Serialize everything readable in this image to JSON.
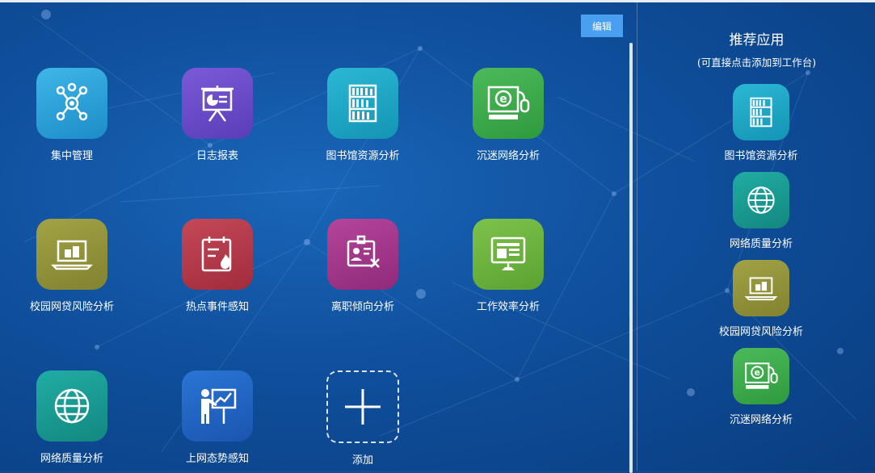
{
  "workspace": {
    "edit_label": "编辑",
    "apps": [
      {
        "label": "集中管理",
        "icon": "network-hub-icon",
        "color": "#2f9ed6"
      },
      {
        "label": "日志报表",
        "icon": "presentation-report-icon",
        "color": "#6a4fc8"
      },
      {
        "label": "图书馆资源分析",
        "icon": "bookshelf-icon",
        "color": "#1ba3c4"
      },
      {
        "label": "沉迷网络分析",
        "icon": "computer-e-mouse-icon",
        "color": "#3aa84a"
      },
      {
        "label": "校园网贷风险分析",
        "icon": "laptop-money-icon",
        "color": "#8f8f3a"
      },
      {
        "label": "热点事件感知",
        "icon": "calendar-fire-icon",
        "color": "#b83a4a"
      },
      {
        "label": "离职倾向分析",
        "icon": "id-badge-x-icon",
        "color": "#a23a8a"
      },
      {
        "label": "工作效率分析",
        "icon": "monitor-window-icon",
        "color": "#6ab23a"
      },
      {
        "label": "网络质量分析",
        "icon": "globe-icon",
        "color": "#1a9e96"
      },
      {
        "label": "上网态势感知",
        "icon": "presenter-chart-icon",
        "color": "#1f63c4"
      }
    ],
    "add_label": "添加"
  },
  "recommend": {
    "title": "推荐应用",
    "subtitle": "(可直接点击添加到工作台)",
    "apps": [
      {
        "label": "图书馆资源分析",
        "icon": "bookshelf-icon",
        "color": "#1ba3c4"
      },
      {
        "label": "网络质量分析",
        "icon": "globe-icon",
        "color": "#1a9e96"
      },
      {
        "label": "校园网贷风险分析",
        "icon": "laptop-money-icon",
        "color": "#8f8f3a"
      },
      {
        "label": "沉迷网络分析",
        "icon": "computer-e-mouse-icon",
        "color": "#3aa84a"
      }
    ]
  }
}
